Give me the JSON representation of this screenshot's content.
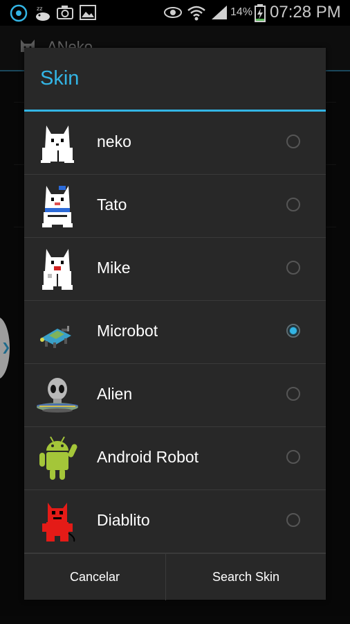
{
  "status_bar": {
    "battery_percent": "14%",
    "time": "07:28 PM"
  },
  "background_app": {
    "title": "ANeko"
  },
  "dialog": {
    "title": "Skin",
    "options": [
      {
        "label": "neko",
        "icon": "neko-cat-icon",
        "selected": false
      },
      {
        "label": "Tato",
        "icon": "tato-cat-icon",
        "selected": false
      },
      {
        "label": "Mike",
        "icon": "mike-cat-icon",
        "selected": false
      },
      {
        "label": "Microbot",
        "icon": "microbot-icon",
        "selected": true
      },
      {
        "label": "Alien",
        "icon": "alien-ufo-icon",
        "selected": false
      },
      {
        "label": "Android Robot",
        "icon": "android-robot-icon",
        "selected": false
      },
      {
        "label": "Diablito",
        "icon": "diablito-devil-icon",
        "selected": false
      }
    ],
    "buttons": {
      "cancel": "Cancelar",
      "search": "Search Skin"
    }
  },
  "colors": {
    "accent": "#33b5e5",
    "dialog_bg": "#282828",
    "android_green": "#a4c639",
    "devil_red": "#e41b17"
  }
}
